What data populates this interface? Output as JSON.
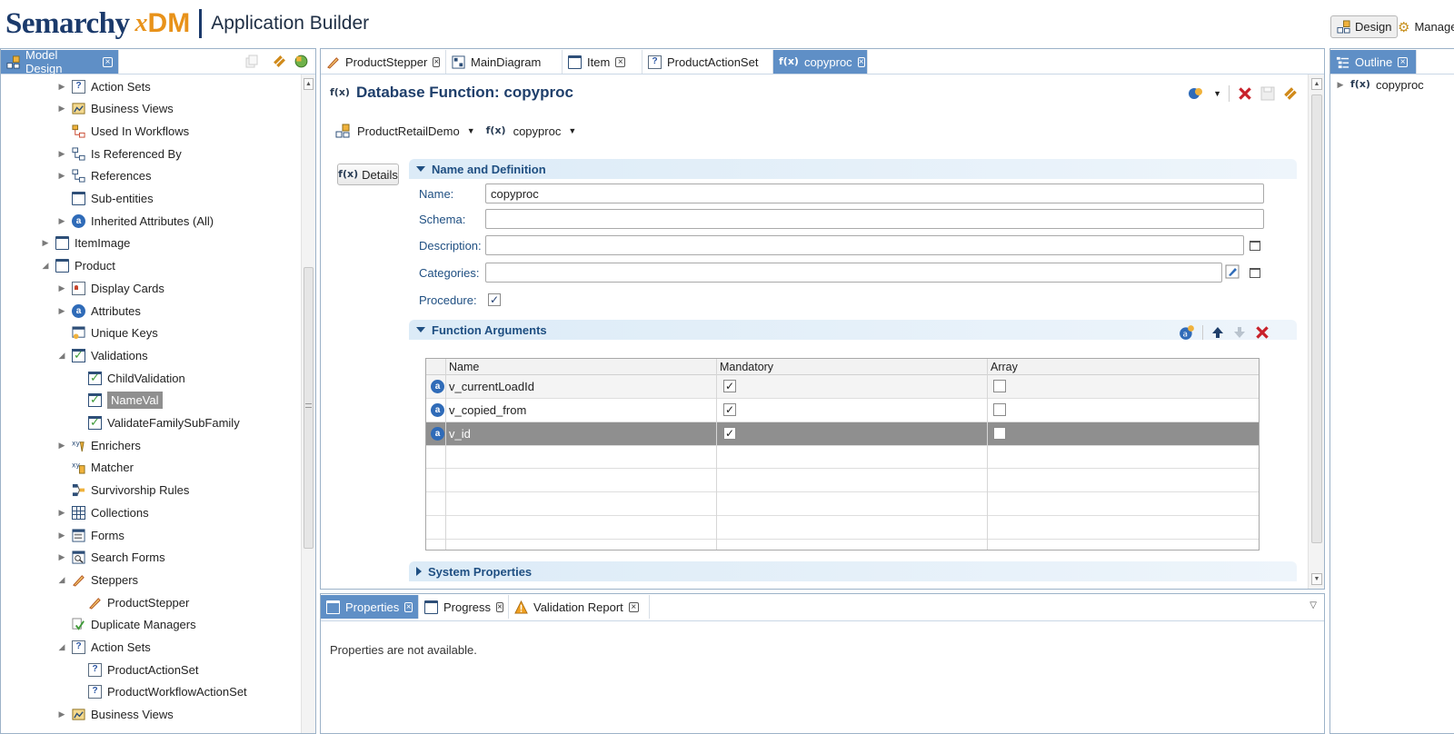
{
  "header": {
    "brand_main": "Semarchy",
    "brand_x": "x",
    "brand_dm": "DM",
    "app_title": "Application Builder",
    "perspectives": [
      "Design",
      "Manage"
    ]
  },
  "model_pane": {
    "tab_label": "Model Design",
    "tree": [
      {
        "label": "Action Sets",
        "icon": "action-set-icon",
        "expand": "collapsed"
      },
      {
        "label": "Business Views",
        "icon": "business-view-icon",
        "expand": "collapsed"
      },
      {
        "label": "Used In Workflows",
        "icon": "workflow-icon",
        "expand": "none"
      },
      {
        "label": "Is Referenced By",
        "icon": "reference-icon",
        "expand": "collapsed"
      },
      {
        "label": "References",
        "icon": "reference-icon",
        "expand": "collapsed"
      },
      {
        "label": "Sub-entities",
        "icon": "entity-icon",
        "expand": "none"
      },
      {
        "label": "Inherited Attributes (All)",
        "icon": "attribute-icon",
        "expand": "collapsed"
      },
      {
        "label": "ItemImage",
        "icon": "entity-icon",
        "expand": "collapsed"
      },
      {
        "label": "Product",
        "icon": "entity-icon",
        "expand": "expanded"
      },
      {
        "label": "Display Cards",
        "icon": "display-card-icon",
        "expand": "collapsed"
      },
      {
        "label": "Attributes",
        "icon": "attribute-icon",
        "expand": "collapsed"
      },
      {
        "label": "Unique Keys",
        "icon": "unique-key-icon",
        "expand": "none"
      },
      {
        "label": "Validations",
        "icon": "validation-icon",
        "expand": "expanded"
      },
      {
        "label": "ChildValidation",
        "icon": "validation-icon",
        "expand": "none"
      },
      {
        "label": "NameVal",
        "icon": "validation-icon",
        "expand": "none",
        "selected": true
      },
      {
        "label": "ValidateFamilySubFamily",
        "icon": "validation-icon",
        "expand": "none"
      },
      {
        "label": "Enrichers",
        "icon": "enricher-icon",
        "expand": "collapsed"
      },
      {
        "label": "Matcher",
        "icon": "matcher-icon",
        "expand": "none"
      },
      {
        "label": "Survivorship Rules",
        "icon": "survivorship-icon",
        "expand": "none"
      },
      {
        "label": "Collections",
        "icon": "collection-icon",
        "expand": "collapsed"
      },
      {
        "label": "Forms",
        "icon": "form-icon",
        "expand": "collapsed"
      },
      {
        "label": "Search Forms",
        "icon": "search-form-icon",
        "expand": "collapsed"
      },
      {
        "label": "Steppers",
        "icon": "stepper-icon",
        "expand": "expanded"
      },
      {
        "label": "ProductStepper",
        "icon": "stepper-icon",
        "expand": "none"
      },
      {
        "label": "Duplicate Managers",
        "icon": "duplicate-manager-icon",
        "expand": "none"
      },
      {
        "label": "Action Sets",
        "icon": "action-set-icon",
        "expand": "expanded"
      },
      {
        "label": "ProductActionSet",
        "icon": "action-set-icon",
        "expand": "none"
      },
      {
        "label": "ProductWorkflowActionSet",
        "icon": "action-set-icon",
        "expand": "none"
      },
      {
        "label": "Business Views",
        "icon": "business-view-icon",
        "expand": "collapsed"
      }
    ]
  },
  "editor": {
    "tabs": [
      {
        "label": "ProductStepper",
        "icon": "stepper-icon"
      },
      {
        "label": "MainDiagram",
        "icon": "diagram-icon"
      },
      {
        "label": "Item",
        "icon": "entity-icon"
      },
      {
        "label": "ProductActionSet",
        "icon": "action-set-icon"
      },
      {
        "label": "copyproc",
        "icon": "function-icon",
        "active": true
      }
    ],
    "title": "Database Function: copyproc",
    "breadcrumb": {
      "model": "ProductRetailDemo",
      "function": "copyproc"
    },
    "details_button": "Details",
    "section_name_def": "Name and Definition",
    "fields": {
      "name_label": "Name:",
      "name_value": "copyproc",
      "schema_label": "Schema:",
      "schema_value": "",
      "description_label": "Description:",
      "description_value": "",
      "categories_label": "Categories:",
      "categories_value": "",
      "procedure_label": "Procedure:",
      "procedure_checked": true
    },
    "section_args": "Function Arguments",
    "section_system": "System Properties",
    "args_columns": [
      "Name",
      "Mandatory",
      "Array"
    ],
    "args_rows": [
      {
        "name": "v_currentLoadId",
        "mandatory": true,
        "array": false
      },
      {
        "name": "v_copied_from",
        "mandatory": true,
        "array": false
      },
      {
        "name": "v_id",
        "mandatory": true,
        "array": false,
        "selected": true
      }
    ]
  },
  "outline": {
    "tab_label": "Outline",
    "item": "copyproc"
  },
  "bottom": {
    "tabs": [
      {
        "label": "Properties",
        "active": true
      },
      {
        "label": "Progress"
      },
      {
        "label": "Validation Report"
      }
    ],
    "message": "Properties are not available."
  },
  "colors": {
    "accent": "#5f8fc6",
    "brand_blue": "#1b3a6b",
    "brand_orange": "#e8921a",
    "delete_red": "#c8202a",
    "selection_gray": "#8f8f8f"
  }
}
